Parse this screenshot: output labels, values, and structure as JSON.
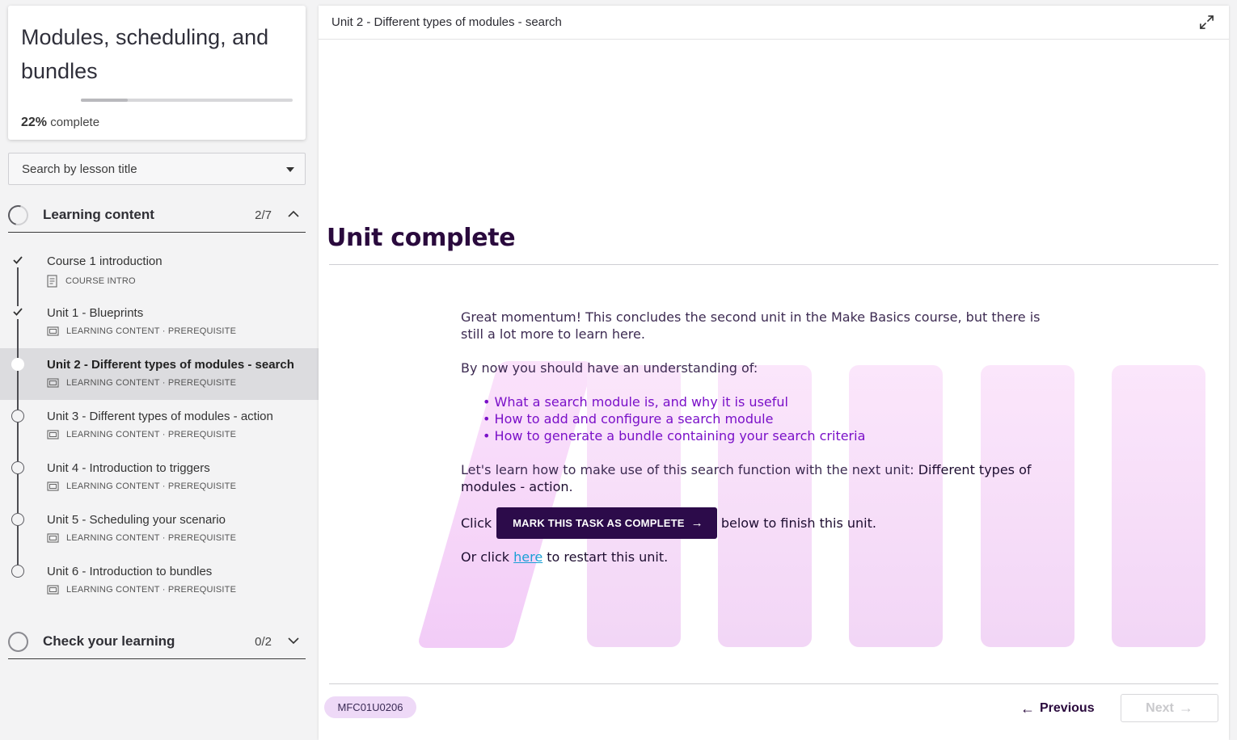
{
  "sidebar": {
    "course_title": "Modules, scheduling, and bundles",
    "progress_percent_label": "22%",
    "progress_suffix": "complete",
    "progress_value": 0.22,
    "search_placeholder": "Search by lesson title",
    "sections": [
      {
        "title": "Learning content",
        "count": "2/7",
        "expanded": true
      },
      {
        "title": "Check your learning",
        "count": "0/2",
        "expanded": false
      }
    ],
    "lessons": [
      {
        "title": "Course 1 introduction",
        "meta": "COURSE INTRO",
        "status": "done",
        "icon": "document-icon"
      },
      {
        "title": "Unit 1 - Blueprints",
        "meta": "LEARNING CONTENT · PREREQUISITE",
        "status": "done",
        "icon": "slides-icon"
      },
      {
        "title": "Unit 2 - Different types of modules - search",
        "meta": "LEARNING CONTENT · PREREQUISITE",
        "status": "current",
        "icon": "slides-icon"
      },
      {
        "title": "Unit 3 - Different types of modules - action",
        "meta": "LEARNING CONTENT · PREREQUISITE",
        "status": "todo",
        "icon": "slides-icon"
      },
      {
        "title": "Unit 4 - Introduction to triggers",
        "meta": "LEARNING CONTENT · PREREQUISITE",
        "status": "todo",
        "icon": "slides-icon"
      },
      {
        "title": "Unit 5 - Scheduling your scenario",
        "meta": "LEARNING CONTENT · PREREQUISITE",
        "status": "todo",
        "icon": "slides-icon"
      },
      {
        "title": "Unit 6 - Introduction to bundles",
        "meta": "LEARNING CONTENT · PREREQUISITE",
        "status": "todo",
        "icon": "slides-icon"
      }
    ]
  },
  "main": {
    "topbar_title": "Unit 2 - Different types of modules - search",
    "heading": "Unit complete",
    "intro": "Great momentum! This concludes the second unit in the Make Basics course, but there is still a lot more to learn here.",
    "understanding_lead": "By now you should have an understanding of:",
    "bullets": [
      "What a search module is, and why it is useful",
      "How to add and configure a search module",
      "How to generate a bundle containing your search criteria"
    ],
    "next_unit_lead": "Let's learn how to make use of this search function with the next unit:",
    "next_unit_name": "Different types of modules - action",
    "click_prefix": "Click",
    "mark_complete_label": "MARK THIS TASK AS COMPLETE",
    "click_suffix": "below to finish this unit.",
    "restart_prefix": "Or click",
    "restart_link": "here",
    "restart_suffix": "to restart this unit.",
    "code_badge": "MFC01U0206",
    "previous_label": "Previous",
    "next_label": "Next"
  },
  "colors": {
    "heading": "#2a0a3d",
    "bullet": "#7a10c8",
    "button_bg": "#2c0b4a",
    "link": "#1a9fd6",
    "badge_bg": "#eed9f7"
  }
}
